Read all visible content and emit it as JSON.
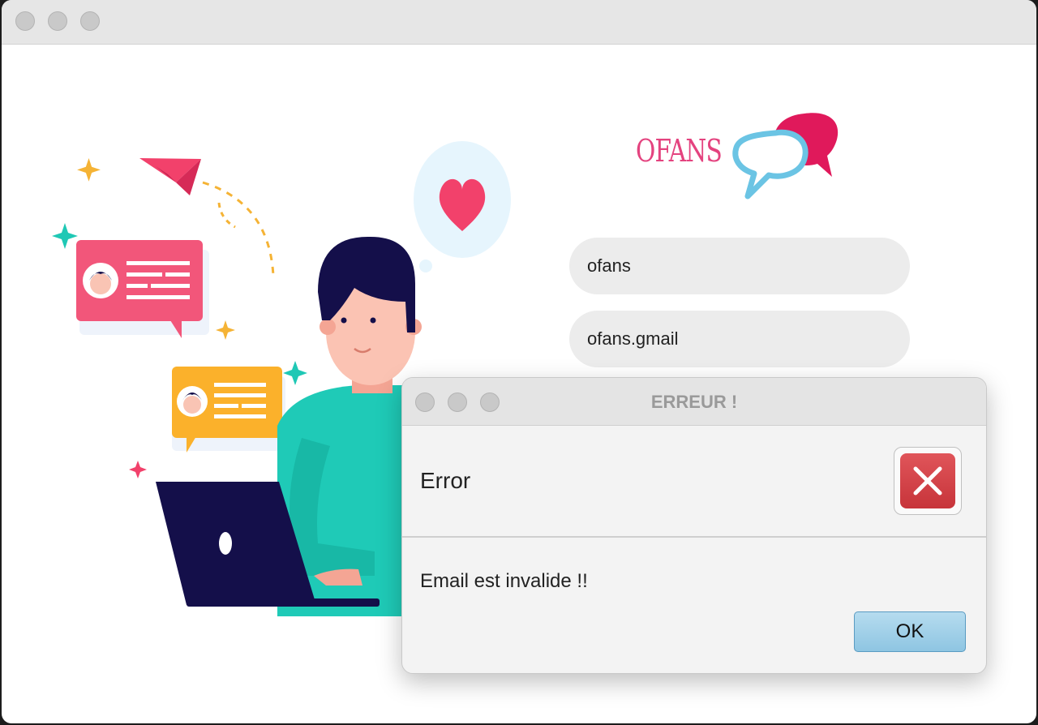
{
  "app": {
    "logo_text": "OFANS",
    "colors": {
      "brand_pink": "#e4437f",
      "bubble_blue": "#6bc4e4",
      "bubble_red": "#e0195b"
    }
  },
  "form": {
    "username_value": "ofans",
    "email_value": "ofans.gmail"
  },
  "dialog": {
    "title": "ERREUR !",
    "header": "Error",
    "message": "Email est invalide !!",
    "ok_label": "OK",
    "icon": "error-x-icon"
  }
}
